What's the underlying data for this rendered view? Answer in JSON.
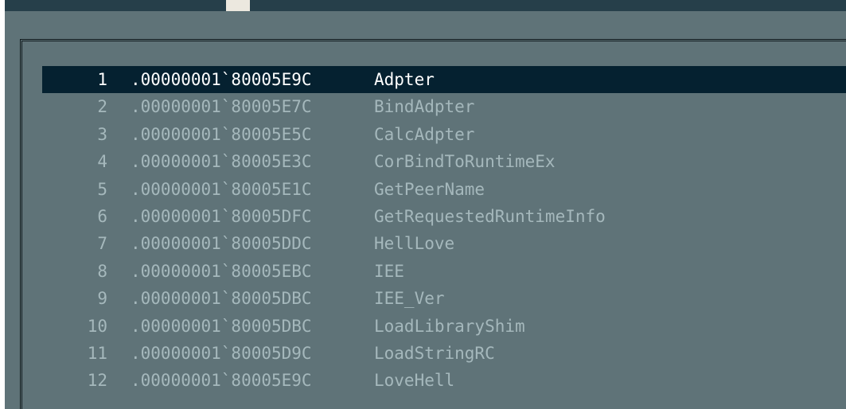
{
  "colors": {
    "titlebar": "#263f4a",
    "client_background": "#5f7378",
    "selection_background": "#052130",
    "selected_text": "#ffffff",
    "row_text": "#a5b8bc",
    "frame_border": "#111a1d"
  },
  "export_list": {
    "selected_index": 0,
    "rows": [
      {
        "num": "1",
        "address": ".00000001`80005E9C",
        "name": "Adpter"
      },
      {
        "num": "2",
        "address": ".00000001`80005E7C",
        "name": "BindAdpter"
      },
      {
        "num": "3",
        "address": ".00000001`80005E5C",
        "name": "CalcAdpter"
      },
      {
        "num": "4",
        "address": ".00000001`80005E3C",
        "name": "CorBindToRuntimeEx"
      },
      {
        "num": "5",
        "address": ".00000001`80005E1C",
        "name": "GetPeerName"
      },
      {
        "num": "6",
        "address": ".00000001`80005DFC",
        "name": "GetRequestedRuntimeInfo"
      },
      {
        "num": "7",
        "address": ".00000001`80005DDC",
        "name": "HellLove"
      },
      {
        "num": "8",
        "address": ".00000001`80005EBC",
        "name": "IEE"
      },
      {
        "num": "9",
        "address": ".00000001`80005DBC",
        "name": "IEE_Ver"
      },
      {
        "num": "10",
        "address": ".00000001`80005DBC",
        "name": "LoadLibraryShim"
      },
      {
        "num": "11",
        "address": ".00000001`80005D9C",
        "name": "LoadStringRC"
      },
      {
        "num": "12",
        "address": ".00000001`80005E9C",
        "name": "LoveHell"
      }
    ]
  }
}
